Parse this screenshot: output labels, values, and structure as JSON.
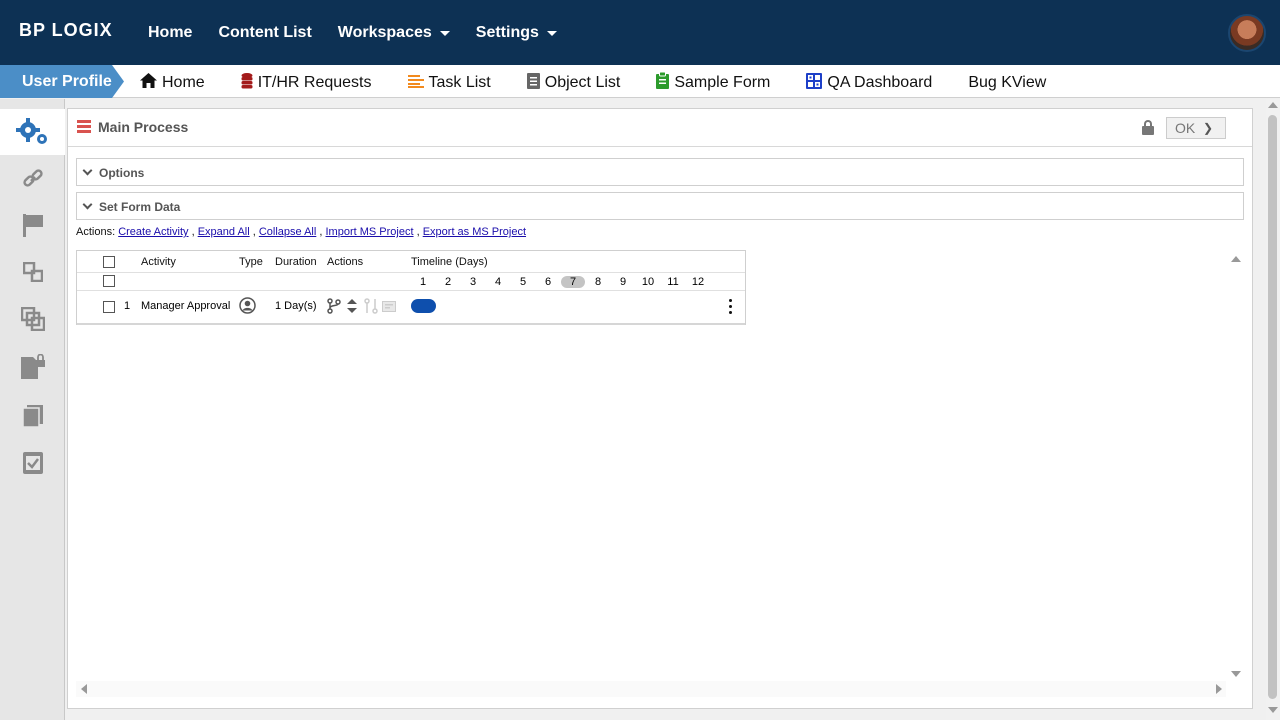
{
  "header": {
    "logo_text": "BP LOGIX",
    "nav": [
      {
        "label": "Home"
      },
      {
        "label": "Content List"
      },
      {
        "label": "Workspaces"
      },
      {
        "label": "Settings"
      }
    ]
  },
  "secondary_nav": {
    "profile": "User Profile",
    "items": [
      {
        "label": "Home",
        "icon": "home-icon"
      },
      {
        "label": "IT/HR Requests",
        "icon": "database-icon"
      },
      {
        "label": "Task List",
        "icon": "list-icon"
      },
      {
        "label": "Object List",
        "icon": "document-icon"
      },
      {
        "label": "Sample Form",
        "icon": "clipboard-icon"
      },
      {
        "label": "QA Dashboard",
        "icon": "dashboard-icon"
      },
      {
        "label": "Bug KView",
        "icon": ""
      }
    ]
  },
  "panel": {
    "title": "Main Process",
    "ok_label": "OK",
    "sections": [
      {
        "label": "Options"
      },
      {
        "label": "Set Form Data"
      }
    ],
    "actions_prefix": "Actions:",
    "actions": [
      "Create Activity",
      "Expand All",
      "Collapse All",
      "Import MS Project",
      "Export as MS Project"
    ]
  },
  "gantt": {
    "headers": {
      "activity": "Activity",
      "type": "Type",
      "duration": "Duration",
      "actions": "Actions",
      "timeline": "Timeline (Days)"
    },
    "days": [
      "1",
      "2",
      "3",
      "4",
      "5",
      "6",
      "7",
      "8",
      "9",
      "10",
      "11",
      "12"
    ],
    "current_day": "7",
    "rows": [
      {
        "index": "1",
        "activity": "Manager Approval",
        "duration": "1 Day(s)",
        "start_day": 1,
        "length_days": 1
      }
    ]
  },
  "colors": {
    "header_bg": "#0d3154",
    "profile_tab": "#4b8ec7",
    "bar": "#0e4fad"
  }
}
